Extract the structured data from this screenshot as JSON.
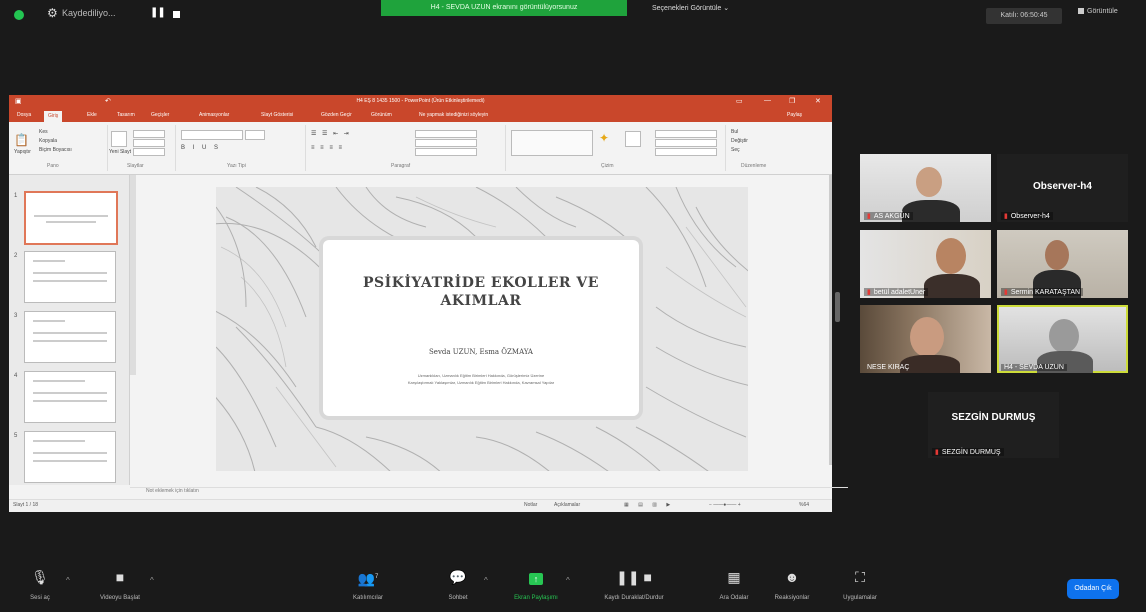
{
  "top": {
    "recording_label": "Kaydediliyo...",
    "speaker_banner": "H4 - SEVDA UZUN ekranını görüntülüyorsunuz",
    "view_options": "Seçenekleri Görüntüle ⌄",
    "zoom_level": "Katılı: 06:50:45",
    "view_button": "Görüntüle"
  },
  "ppt": {
    "title": "H4 EŞ 8 1435 1500 - PowerPoint (Ürün Etkinleştirilemedi)",
    "tabs": [
      "Dosya",
      "Giriş",
      "Ekle",
      "Tasarım",
      "Geçişler",
      "Animasyonlar",
      "Slayt Gösterisi",
      "Gözden Geçir",
      "Görünüm",
      "Ne yapmak istediğinizi söyleyin"
    ],
    "share_label": "Paylaş",
    "ribbon": {
      "clipboard": "Pano",
      "slides": "Slaytlar",
      "font": "Yazı Tipi",
      "paragraph": "Paragraf",
      "drawing": "Çizim",
      "editing": "Düzenleme",
      "paste": "Yapıştır",
      "cut": "Kes",
      "copy": "Kopyala",
      "format_painter": "Biçim Boyacısı",
      "new_slide": "Yeni Slayt",
      "find": "Bul",
      "replace": "Değiştir",
      "select": "Seç"
    },
    "slide": {
      "title_line1": "PSİKİYATRİDE EKOLLER VE",
      "title_line2": "AKIMLAR",
      "authors": "Sevda UZUN, Esma ÖZMAYA",
      "affil1": "Uzmanlıkları, Uzmanlık Eğitim Birimleri Hakkında, Görüşlerimiz Üzerine",
      "affil2": "Karşılaştırmalı Yaklaşımlar, Uzmanlık Eğitim Birimleri Hakkında, Kavramsal Yapılar"
    },
    "notes_placeholder": "Not eklemek için tıklatın",
    "status_slide": "Slayt 1 / 18",
    "status_notes": "Notlar",
    "status_comments": "Açıklamalar",
    "status_zoom": "%64"
  },
  "tiles": [
    {
      "name": "AS AKGÜN",
      "big": ""
    },
    {
      "name": "Observer-h4",
      "big": "Observer-h4"
    },
    {
      "name": "betül adaletUner",
      "big": ""
    },
    {
      "name": "Sermin KARATAŞTAN",
      "big": ""
    },
    {
      "name": "NESE KIRAÇ",
      "big": ""
    },
    {
      "name": "H4 - SEVDA UZUN",
      "big": ""
    },
    {
      "name": "SEZGİN DURMUŞ",
      "big": "SEZGİN DURMUŞ"
    }
  ],
  "toolbar": {
    "mute": "Sesi aç",
    "video": "Videoyu Başlat",
    "participants": "Katılımcılar",
    "participants_count": "7",
    "chat": "Sohbet",
    "share": "Ekran Paylaşımı",
    "record": "Kaydı Duraklat/Durdur",
    "breakout": "Ara Odalar",
    "reactions": "Reaksiyonlar",
    "apps": "Uygulamalar",
    "leave": "Odadan Çık"
  },
  "colors": {
    "ppt_accent": "#c9472b",
    "share_green": "#27c653",
    "active_speaker": "#cddc39",
    "leave_blue": "#0e72ed"
  }
}
